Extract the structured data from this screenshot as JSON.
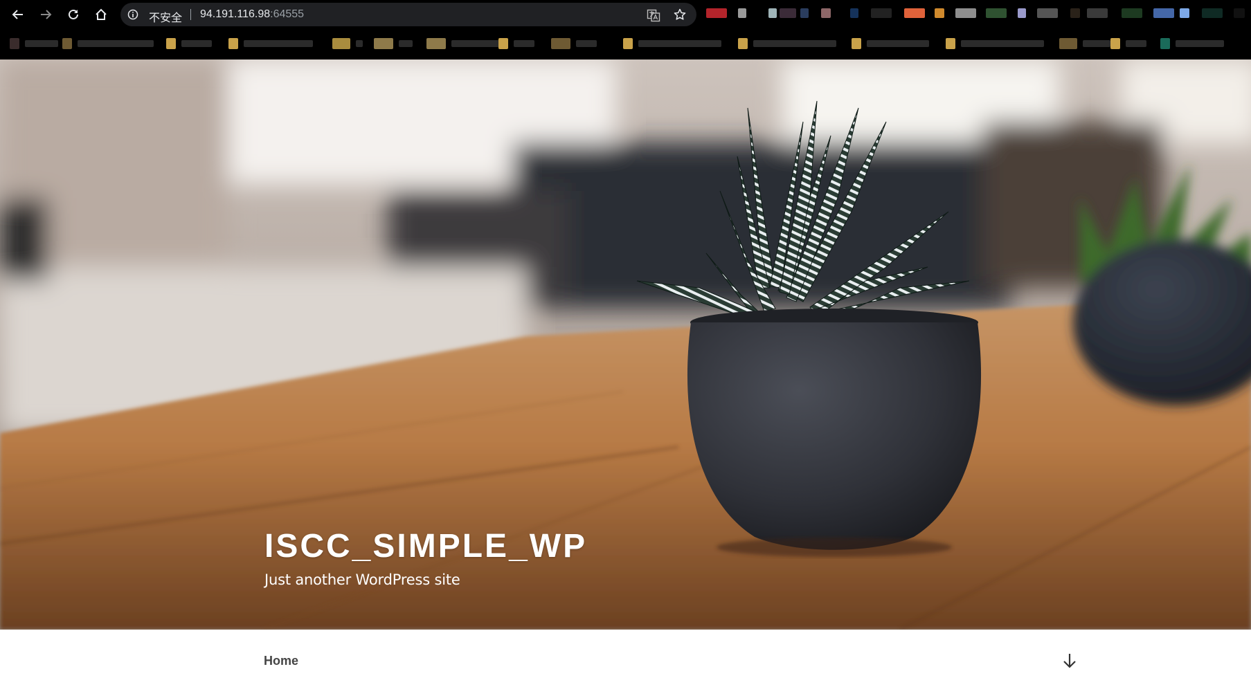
{
  "browser": {
    "security_label": "不安全",
    "url_host": "94.191.116.98",
    "url_port": ":64555",
    "icons": {
      "back": "back-arrow-icon",
      "forward": "forward-arrow-icon",
      "reload": "reload-icon",
      "home": "home-icon",
      "info": "info-icon",
      "translate": "translate-icon",
      "bookmark": "star-icon"
    }
  },
  "site": {
    "title": "ISCC_SIMPLE_WP",
    "description": "Just another WordPress site"
  },
  "navigation": {
    "items": [
      {
        "label": "Home"
      }
    ],
    "scroll_icon": "arrow-down-icon"
  },
  "colors": {
    "chrome_bg": "#000000",
    "omnibox_bg": "#202124",
    "title_color": "#ffffff",
    "nav_text": "#444444"
  }
}
